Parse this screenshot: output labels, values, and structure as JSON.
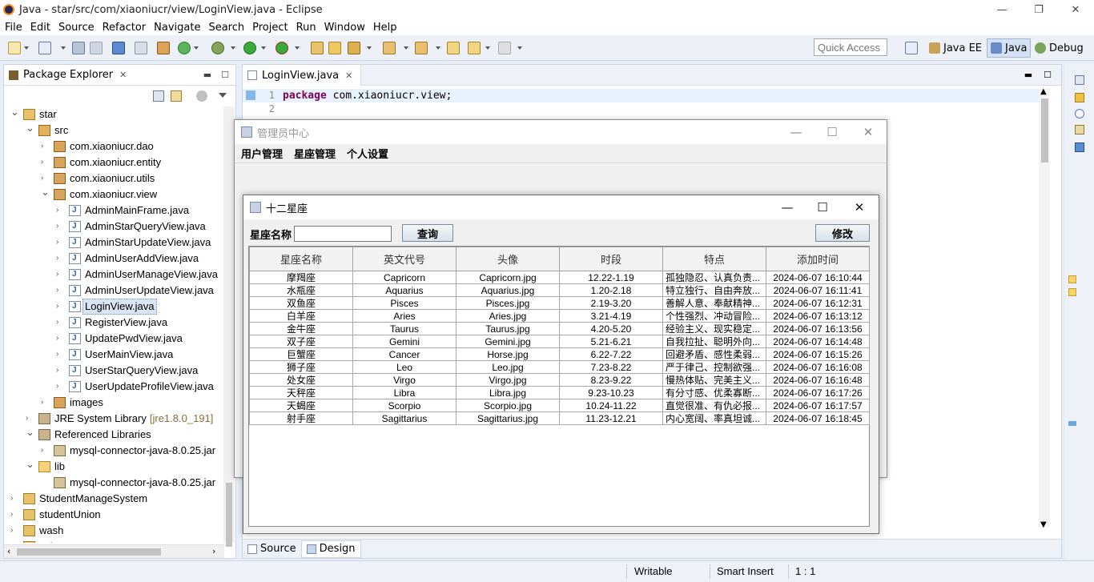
{
  "window": {
    "title": "Java - star/src/com/xiaoniucr/view/LoginView.java - Eclipse"
  },
  "menu": [
    "File",
    "Edit",
    "Source",
    "Refactor",
    "Navigate",
    "Search",
    "Project",
    "Run",
    "Window",
    "Help"
  ],
  "toolbar": {
    "quick_access": "Quick Access",
    "perspectives": [
      "Java EE",
      "Java",
      "Debug"
    ]
  },
  "package_explorer": {
    "title": "Package Explorer",
    "tree": [
      {
        "label": "star",
        "level": 0,
        "twisty": "open",
        "icon": "project"
      },
      {
        "label": "src",
        "level": 1,
        "twisty": "open",
        "icon": "src"
      },
      {
        "label": "com.xiaoniucr.dao",
        "level": 2,
        "twisty": "closed",
        "icon": "pkg"
      },
      {
        "label": "com.xiaoniucr.entity",
        "level": 2,
        "twisty": "closed",
        "icon": "pkg"
      },
      {
        "label": "com.xiaoniucr.utils",
        "level": 2,
        "twisty": "closed",
        "icon": "pkg"
      },
      {
        "label": "com.xiaoniucr.view",
        "level": 2,
        "twisty": "open",
        "icon": "pkg"
      },
      {
        "label": "AdminMainFrame.java",
        "level": 3,
        "twisty": "closed",
        "icon": "java"
      },
      {
        "label": "AdminStarQueryView.java",
        "level": 3,
        "twisty": "closed",
        "icon": "java"
      },
      {
        "label": "AdminStarUpdateView.java",
        "level": 3,
        "twisty": "closed",
        "icon": "java"
      },
      {
        "label": "AdminUserAddView.java",
        "level": 3,
        "twisty": "closed",
        "icon": "java"
      },
      {
        "label": "AdminUserManageView.java",
        "level": 3,
        "twisty": "closed",
        "icon": "java"
      },
      {
        "label": "AdminUserUpdateView.java",
        "level": 3,
        "twisty": "closed",
        "icon": "java"
      },
      {
        "label": "LoginView.java",
        "level": 3,
        "twisty": "closed",
        "icon": "java",
        "selected": true
      },
      {
        "label": "RegisterView.java",
        "level": 3,
        "twisty": "closed",
        "icon": "java"
      },
      {
        "label": "UpdatePwdView.java",
        "level": 3,
        "twisty": "closed",
        "icon": "java"
      },
      {
        "label": "UserMainView.java",
        "level": 3,
        "twisty": "closed",
        "icon": "java"
      },
      {
        "label": "UserStarQueryView.java",
        "level": 3,
        "twisty": "closed",
        "icon": "java"
      },
      {
        "label": "UserUpdateProfileView.java",
        "level": 3,
        "twisty": "closed",
        "icon": "java"
      },
      {
        "label": "images",
        "level": 2,
        "twisty": "closed",
        "icon": "pkg"
      },
      {
        "label": "JRE System Library",
        "suffix": "[jre1.8.0_191]",
        "level": 1,
        "twisty": "closed",
        "icon": "lib"
      },
      {
        "label": "Referenced Libraries",
        "level": 1,
        "twisty": "open",
        "icon": "lib"
      },
      {
        "label": "mysql-connector-java-8.0.25.jar",
        "level": 2,
        "twisty": "closed",
        "icon": "jar"
      },
      {
        "label": "lib",
        "level": 1,
        "twisty": "open",
        "icon": "folder"
      },
      {
        "label": "mysql-connector-java-8.0.25.jar",
        "level": 2,
        "twisty": "none",
        "icon": "jar"
      },
      {
        "label": "StudentManageSystem",
        "level": 0,
        "twisty": "closed",
        "icon": "project"
      },
      {
        "label": "studentUnion",
        "level": 0,
        "twisty": "closed",
        "icon": "project"
      },
      {
        "label": "wash",
        "level": 0,
        "twisty": "closed",
        "icon": "project"
      },
      {
        "label": "yqjx",
        "level": 0,
        "twisty": "closed",
        "icon": "project"
      }
    ]
  },
  "editor": {
    "tab": "LoginView.java",
    "lines": [
      {
        "num": "1",
        "keyword": "package",
        "text": " com.xiaoniucr.view;"
      },
      {
        "num": "2",
        "keyword": "",
        "text": ""
      }
    ],
    "bottom_tabs": [
      "Source",
      "Design"
    ]
  },
  "statusbar": {
    "writable": "Writable",
    "insert_mode": "Smart Insert",
    "position": "1 : 1"
  },
  "admin_frame": {
    "title": "管理员中心",
    "menus": [
      "用户管理",
      "星座管理",
      "个人设置"
    ]
  },
  "zodiac_frame": {
    "title": "十二星座",
    "search_label": "星座名称",
    "search_value": "",
    "search_button": "查询",
    "modify_button": "修改",
    "columns": [
      "星座名称",
      "英文代号",
      "头像",
      "时段",
      "特点",
      "添加时间"
    ],
    "rows": [
      [
        "摩羯座",
        "Capricorn",
        "Capricorn.jpg",
        "12.22-1.19",
        "孤独隐忍、认真负责...",
        "2024-06-07 16:10:44"
      ],
      [
        "水瓶座",
        "Aquarius",
        "Aquarius.jpg",
        "1.20-2.18",
        "特立独行、自由奔放...",
        "2024-06-07 16:11:41"
      ],
      [
        "双鱼座",
        "Pisces",
        "Pisces.jpg",
        "2.19-3.20",
        "善解人意、奉献精神...",
        "2024-06-07 16:12:31"
      ],
      [
        "白羊座",
        "Aries",
        "Aries.jpg",
        "3.21-4.19",
        "个性强烈、冲动冒险...",
        "2024-06-07 16:13:12"
      ],
      [
        "金牛座",
        "Taurus",
        "Taurus.jpg",
        "4.20-5.20",
        "经验主义、现实稳定...",
        "2024-06-07 16:13:56"
      ],
      [
        "双子座",
        "Gemini",
        "Gemini.jpg",
        "5.21-6.21",
        "自我拉扯、聪明外向...",
        "2024-06-07 16:14:48"
      ],
      [
        "巨蟹座",
        "Cancer",
        "Horse.jpg",
        "6.22-7.22",
        "回避矛盾、感性柔弱...",
        "2024-06-07 16:15:26"
      ],
      [
        "狮子座",
        "Leo",
        "Leo.jpg",
        "7.23-8.22",
        "严于律己、控制欲强...",
        "2024-06-07 16:16:08"
      ],
      [
        "处女座",
        "Virgo",
        "Virgo.jpg",
        "8.23-9.22",
        "慢热体贴、完美主义...",
        "2024-06-07 16:16:48"
      ],
      [
        "天秤座",
        "Libra",
        "Libra.jpg",
        "9.23-10.23",
        "有分寸感、优柔寡断...",
        "2024-06-07 16:17:26"
      ],
      [
        "天蝎座",
        "Scorpio",
        "Scorpio.jpg",
        "10.24-11.22",
        "直觉很准、有仇必报...",
        "2024-06-07 16:17:57"
      ],
      [
        "射手座",
        "Sagittarius",
        "Sagittarius.jpg",
        "11.23-12.21",
        "内心宽阔、率真坦诚...",
        "2024-06-07 16:18:45"
      ]
    ]
  }
}
